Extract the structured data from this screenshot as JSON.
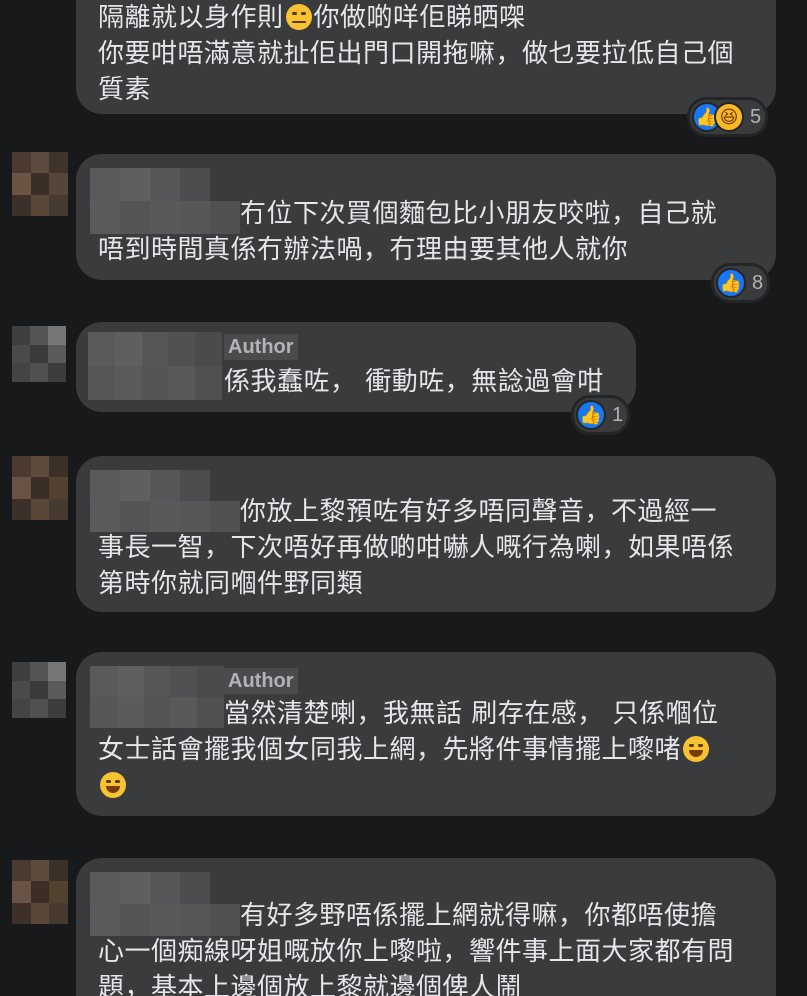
{
  "colors": {
    "background": "#18191a",
    "bubble": "#3a3b3c",
    "text": "#e4e6eb",
    "muted": "#b0b3b8",
    "like": "#1877f2",
    "haha": "#f7b928"
  },
  "comments": [
    {
      "line1": "隔離就以身作則",
      "line1_after": "你做啲咩佢睇晒㗎",
      "line2": "你要咁唔滿意就扯佢出門口開拖嘛，做乜要拉低自己個",
      "line3": "質素",
      "reactions": [
        "like-icon",
        "haha-icon"
      ],
      "count": "5"
    },
    {
      "line1": "冇位下次買個麵包比小朋友咬啦，自己就",
      "line2": "唔到時間真係冇辦法喎，冇理由要其他人就你",
      "reactions": [
        "like-icon"
      ],
      "count": "8"
    },
    {
      "author_tag": "Author",
      "line1": "係我蠢咗， 衝動咗，無諗過會咁",
      "reactions": [
        "like-icon"
      ],
      "count": "1"
    },
    {
      "line1": "你放上黎預咗有好多唔同聲音，不過經一",
      "line2": "事長一智，下次唔好再做啲咁嚇人嘅行為喇，如果唔係",
      "line3": "第時你就同嗰件野同類"
    },
    {
      "author_tag": "Author",
      "line1": "當然清楚喇，我無話 刷存在感， 只係嗰位",
      "line2": "女士話會擺我個女同我上網，先將件事情擺上嚟啫"
    },
    {
      "line1": "有好多野唔係擺上網就得嘛，你都唔使擔",
      "line2": "心一個痴線呀姐嘅放你上嚟啦，響件事上面大家都有問",
      "line3": "題，基本上邊個放上黎就邊個俾人鬧"
    }
  ]
}
